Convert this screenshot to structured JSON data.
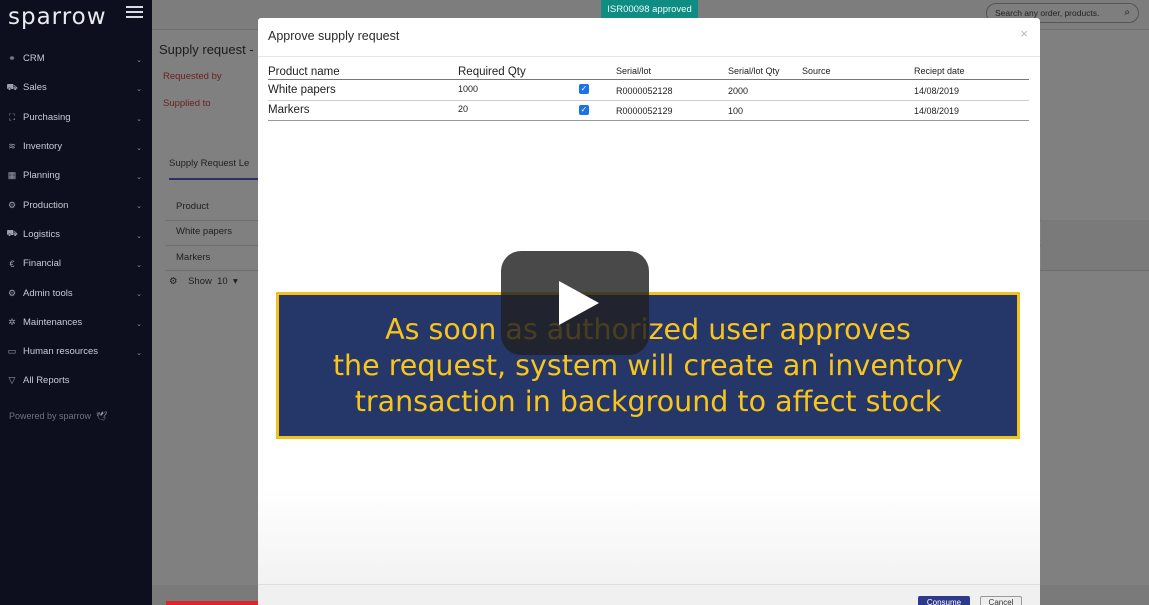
{
  "app": {
    "logo": "sparrow"
  },
  "sidebar": {
    "items": [
      {
        "label": "CRM",
        "icon": "handshake-icon",
        "glyph": "⚭"
      },
      {
        "label": "Sales",
        "icon": "cart-icon",
        "glyph": "⛟"
      },
      {
        "label": "Purchasing",
        "icon": "purchasing-icon",
        "glyph": "⛶"
      },
      {
        "label": "Inventory",
        "icon": "layers-icon",
        "glyph": "≋"
      },
      {
        "label": "Planning",
        "icon": "calendar-icon",
        "glyph": "▦"
      },
      {
        "label": "Production",
        "icon": "gears-icon",
        "glyph": "⚙"
      },
      {
        "label": "Logistics",
        "icon": "truck-icon",
        "glyph": "⛟"
      },
      {
        "label": "Financial",
        "icon": "euro-icon",
        "glyph": "€"
      },
      {
        "label": "Admin tools",
        "icon": "gear-icon",
        "glyph": "⚙"
      },
      {
        "label": "Maintenances",
        "icon": "wrench-icon",
        "glyph": "✲"
      },
      {
        "label": "Human resources",
        "icon": "id-card-icon",
        "glyph": "▭"
      },
      {
        "label": "All Reports",
        "icon": "filter-icon",
        "glyph": "▽"
      }
    ],
    "powered_by": "Powered by sparrow"
  },
  "topbar": {
    "search_placeholder": "Search any order, products."
  },
  "background_page": {
    "title": "Supply request - I",
    "requested_by_label": "Requested by",
    "supplied_to_label": "Supplied to",
    "tab_label": "Supply Request Le",
    "table_header": "Product",
    "rows": [
      "White papers",
      "Markers"
    ],
    "show_label": "Show",
    "show_value": "10"
  },
  "toast": {
    "message": "ISR00098 approved"
  },
  "modal": {
    "title": "Approve supply request",
    "columns": {
      "product_name": "Product name",
      "required_qty": "Required Qty",
      "serial_lot": "Serial/lot",
      "serial_lot_qty": "Serial/lot Qty",
      "source": "Source",
      "receipt_date": "Reciept date"
    },
    "rows": [
      {
        "product": "White papers",
        "qty": "1000",
        "checked": true,
        "serial": "R0000052128",
        "serial_qty": "2000",
        "source": "",
        "date": "14/08/2019"
      },
      {
        "product": "Markers",
        "qty": "20",
        "checked": true,
        "serial": "R0000052129",
        "serial_qty": "100",
        "source": "",
        "date": "14/08/2019"
      }
    ],
    "consume_label": "Consume",
    "cancel_label": "Cancel"
  },
  "caption": {
    "lines": [
      "As soon as authorized user approves",
      "the request, system will create an inventory",
      "transaction in background to affect stock"
    ]
  },
  "video": {
    "progress": 0.27
  },
  "colors": {
    "sidebar": "#0d0f1e",
    "toast": "#0f8d82",
    "banner_bg": "#253668",
    "banner_text": "#f7c51c",
    "checkbox": "#1a73e8",
    "progress": "#e0242a"
  }
}
